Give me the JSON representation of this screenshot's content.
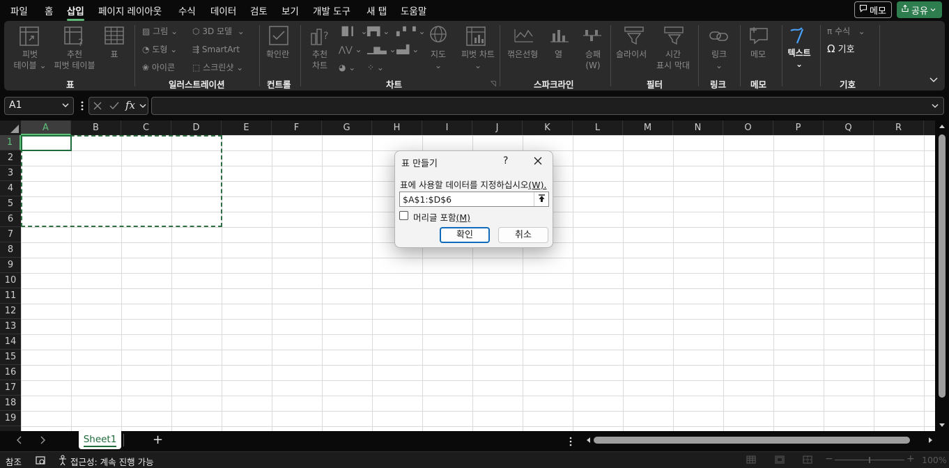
{
  "menu": {
    "items": [
      "파일",
      "홈",
      "삽입",
      "페이지 레이아웃",
      "수식",
      "데이터",
      "검토",
      "보기",
      "개발 도구",
      "새 탭",
      "도움말"
    ],
    "active": "삽입",
    "memo_label": "메모",
    "share_label": "공유"
  },
  "ribbon": {
    "table": {
      "group_label": "표",
      "pivot_table_l1": "피벗",
      "pivot_table_l2": "테이블",
      "recommended_pivot_l1": "추천",
      "recommended_pivot_l2": "피벗 테이블",
      "table_label": "표"
    },
    "illustrations": {
      "group_label": "일러스트레이션",
      "picture": "그림",
      "shapes": "도형",
      "icons": "아이콘",
      "models_3d": "3D 모델",
      "smartart": "SmartArt",
      "screenshot": "스크린샷"
    },
    "controls": {
      "group_label": "컨트롤",
      "checkbox": "확인란"
    },
    "charts": {
      "group_label": "차트",
      "recommended_l1": "추천",
      "recommended_l2": "차트",
      "maps": "지도",
      "pivot_chart": "피벗 차트"
    },
    "sparklines": {
      "group_label": "스파크라인",
      "line": "꺾은선형",
      "column": "열",
      "winloss_l1": "승패",
      "winloss_l2": "(W)"
    },
    "filters": {
      "group_label": "필터",
      "slicer": "슬라이서",
      "timeline_l1": "시간",
      "timeline_l2": "표시 막대"
    },
    "links": {
      "group_label": "링크",
      "link": "링크"
    },
    "comments": {
      "group_label": "메모",
      "comment": "메모"
    },
    "text": {
      "text_label": "텍스트"
    },
    "symbols": {
      "group_label": "기호",
      "equation": "수식",
      "symbol": "기호"
    }
  },
  "formula_bar": {
    "name_box": "A1",
    "fx": "fx",
    "formula": ""
  },
  "grid": {
    "columns": [
      "A",
      "B",
      "C",
      "D",
      "E",
      "F",
      "G",
      "H",
      "I",
      "J",
      "K",
      "L",
      "M",
      "N",
      "O",
      "P",
      "Q",
      "R"
    ],
    "rows": [
      "1",
      "2",
      "3",
      "4",
      "5",
      "6",
      "7",
      "8",
      "9",
      "10",
      "11",
      "12",
      "13",
      "14",
      "15",
      "16",
      "17",
      "18",
      "19"
    ],
    "active_cell": "A1"
  },
  "dialog": {
    "title": "표 만들기",
    "help": "?",
    "prompt_text": "표에 사용할 데이터를 지정하십시오",
    "prompt_key": "(W).",
    "range_value": "$A$1:$D$6",
    "header_checkbox_text": "머리글 포함",
    "header_checkbox_key": "(M)",
    "header_checked": false,
    "ok_label": "확인",
    "cancel_label": "취소"
  },
  "tabs": {
    "sheet_name": "Sheet1",
    "add_label": "+"
  },
  "status": {
    "mode": "참조",
    "accessibility": "접근성: 계속 진행 가능",
    "zoom": "100%"
  }
}
